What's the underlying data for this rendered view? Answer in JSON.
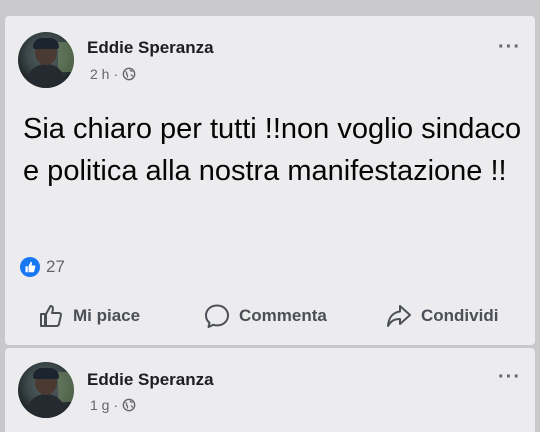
{
  "posts": [
    {
      "author": "Eddie Speranza",
      "time": "2 h",
      "separator": "·",
      "privacy_icon": "globe-icon",
      "text": "Sia chiaro per tutti !!non voglio sindaco e politica alla nostra manifestazione !!",
      "reaction_count": "27",
      "reaction_icon": "like-icon",
      "more_label": "···",
      "actions": {
        "like": "Mi piace",
        "comment": "Commenta",
        "share": "Condividi"
      }
    },
    {
      "author": "Eddie Speranza",
      "time": "1 g",
      "separator": "·",
      "privacy_icon": "globe-icon",
      "more_label": "···"
    }
  ],
  "colors": {
    "background": "#c9c9cb",
    "card": "#ececee",
    "text": "#050505",
    "secondary_text": "#65676b",
    "like_blue": "#1877f2"
  }
}
